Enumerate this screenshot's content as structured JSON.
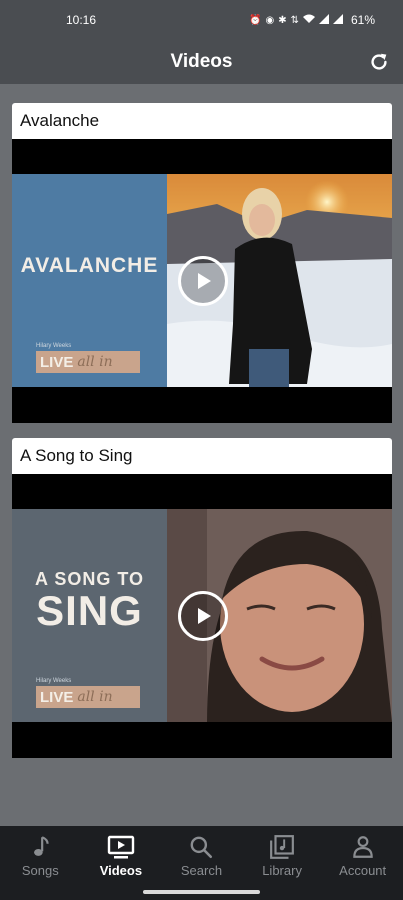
{
  "status_bar": {
    "time": "10:16",
    "icons": [
      "alarm-icon",
      "cast-icon",
      "bluetooth-icon",
      "data-icon",
      "wifi-icon",
      "signal-icon",
      "signal-icon"
    ],
    "battery": "61%"
  },
  "header": {
    "title": "Videos",
    "refresh_icon": "refresh-icon"
  },
  "videos": [
    {
      "title": "Avalanche",
      "thumb_title": "AVALANCHE",
      "artist": "Hilary Weeks",
      "logo_a": "LIVE",
      "logo_b": "all in",
      "thumb_color": "#4e7ba3"
    },
    {
      "title": "A Song to Sing",
      "thumb_title_line1": "A SONG TO",
      "thumb_title_line2": "SING",
      "artist": "Hilary Weeks",
      "logo_a": "LIVE",
      "logo_b": "all in",
      "thumb_color": "#5c6670"
    }
  ],
  "bottom_nav": {
    "items": [
      {
        "label": "Songs",
        "icon": "music-note-icon",
        "active": false
      },
      {
        "label": "Videos",
        "icon": "video-tv-icon",
        "active": true
      },
      {
        "label": "Search",
        "icon": "search-icon",
        "active": false
      },
      {
        "label": "Library",
        "icon": "library-icon",
        "active": false
      },
      {
        "label": "Account",
        "icon": "account-icon",
        "active": false
      }
    ]
  },
  "colors": {
    "background": "#6b6e72",
    "header": "#4a4d51",
    "nav": "#1c1e21"
  }
}
